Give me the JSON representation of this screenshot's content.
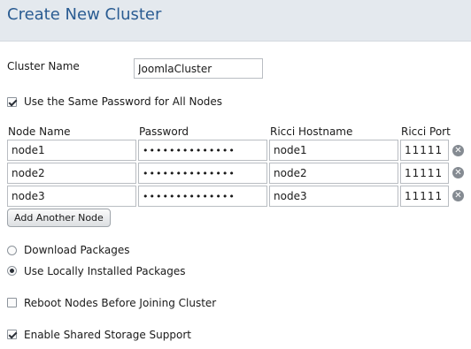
{
  "header": {
    "title": "Create New Cluster"
  },
  "cluster_name": {
    "label": "Cluster Name",
    "value": "JoomlaCluster"
  },
  "same_password": {
    "label": "Use the Same Password for All Nodes",
    "checked": true
  },
  "nodes_table": {
    "columns": [
      "Node Name",
      "Password",
      "Ricci Hostname",
      "Ricci Port"
    ],
    "rows": [
      {
        "name": "node1",
        "password": "••••••••••••••",
        "hostname": "node1",
        "port": "11111"
      },
      {
        "name": "node2",
        "password": "••••••••••••••",
        "hostname": "node2",
        "port": "11111"
      },
      {
        "name": "node3",
        "password": "••••••••••••••",
        "hostname": "node3",
        "port": "11111"
      }
    ],
    "remove_icon": "remove-circle-icon"
  },
  "add_node_button": "Add Another Node",
  "packages": {
    "options": [
      "Download Packages",
      "Use Locally Installed Packages"
    ],
    "selected": "Use Locally Installed Packages"
  },
  "reboot": {
    "label": "Reboot Nodes Before Joining Cluster",
    "checked": false
  },
  "shared_storage": {
    "label": "Enable Shared Storage Support",
    "checked": true
  }
}
